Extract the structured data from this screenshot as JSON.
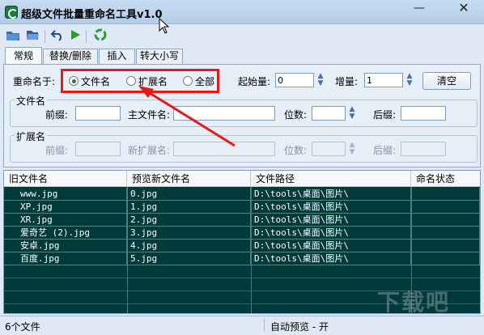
{
  "window": {
    "title": "超级文件批量重命名工具v1.0",
    "minimize_glyph": "—",
    "close_glyph": "✕"
  },
  "toolbar": {
    "icons": [
      "open-folder-icon",
      "open-files-icon",
      "undo-icon",
      "run-icon",
      "recycle-icon"
    ]
  },
  "tabs": [
    {
      "label": "常规",
      "active": true
    },
    {
      "label": "替换/删除",
      "active": false
    },
    {
      "label": "插入",
      "active": false
    },
    {
      "label": "转大小写",
      "active": false
    }
  ],
  "rename_target": {
    "label": "重命名于:",
    "options": [
      {
        "label": "文件名",
        "selected": true
      },
      {
        "label": "扩展名",
        "selected": false
      },
      {
        "label": "全部",
        "selected": false
      }
    ]
  },
  "start": {
    "label": "起始量:",
    "value": "0"
  },
  "increment": {
    "label": "增量:",
    "value": "1"
  },
  "clear_button": "清空",
  "filename_group": {
    "title": "文件名",
    "prefix_label": "前缀:",
    "prefix_value": "",
    "main_label": "主文件名:",
    "main_value": "",
    "digits_label": "位数:",
    "digits_value": "",
    "suffix_label": "后缀:",
    "suffix_value": ""
  },
  "extension_group": {
    "title": "扩展名",
    "prefix_label": "前缀:",
    "new_ext_label": "新扩展名:",
    "digits_label": "位数:",
    "suffix_label": "后缀:"
  },
  "table": {
    "columns": [
      "旧文件名",
      "预览新文件名",
      "文件路径",
      "命名状态"
    ],
    "rows": [
      {
        "old": "www.jpg",
        "new": "0.jpg",
        "path": "D:\\tools\\桌面\\图片\\",
        "status": ""
      },
      {
        "old": "XP.jpg",
        "new": "1.jpg",
        "path": "D:\\tools\\桌面\\图片\\",
        "status": ""
      },
      {
        "old": "XR.jpg",
        "new": "2.jpg",
        "path": "D:\\tools\\桌面\\图片\\",
        "status": ""
      },
      {
        "old": "爱奇艺 (2).jpg",
        "new": "3.jpg",
        "path": "D:\\tools\\桌面\\图片\\",
        "status": ""
      },
      {
        "old": "安卓.jpg",
        "new": "4.jpg",
        "path": "D:\\tools\\桌面\\图片\\",
        "status": ""
      },
      {
        "old": "百度.jpg",
        "new": "5.jpg",
        "path": "D:\\tools\\桌面\\图片\\",
        "status": ""
      }
    ]
  },
  "status": {
    "left": "6个文件",
    "right": "自动预览 - 开"
  },
  "watermark": "下载吧",
  "colors": {
    "table_bg": "#003b3b",
    "highlight": "#e41b1b",
    "accent": "#2e7a2e"
  }
}
